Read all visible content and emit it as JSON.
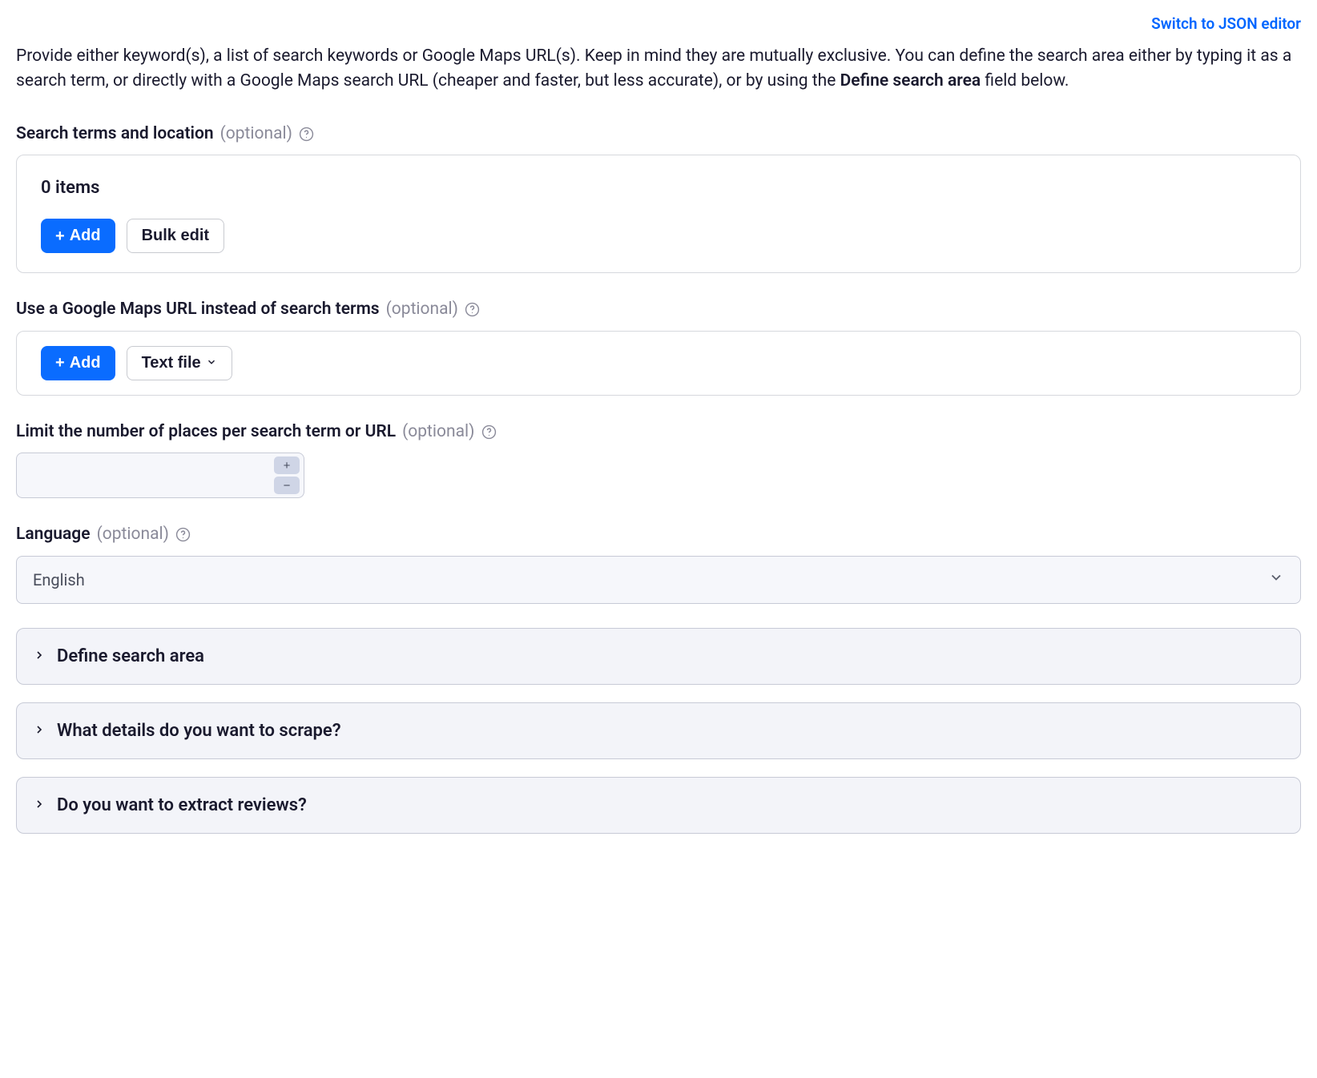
{
  "header": {
    "json_editor_link": "Switch to JSON editor"
  },
  "description": {
    "prefix": "Provide either keyword(s), a list of search keywords or Google Maps URL(s). Keep in mind they are mutually exclusive. You can define the search area either by typing it as a search term, or directly with a Google Maps search URL (cheaper and faster, but less accurate), or by using the ",
    "bold": "Define search area",
    "suffix": " field below."
  },
  "labels": {
    "optional": "(optional)"
  },
  "search_terms": {
    "label": "Search terms and location",
    "items_count": "0 items",
    "add_label": "Add",
    "bulk_edit_label": "Bulk edit"
  },
  "url_section": {
    "label": "Use a Google Maps URL instead of search terms",
    "add_label": "Add",
    "text_file_label": "Text file"
  },
  "limit_section": {
    "label": "Limit the number of places per search term or URL",
    "value": ""
  },
  "language_section": {
    "label": "Language",
    "value": "English"
  },
  "accordions": [
    {
      "title": "Define search area"
    },
    {
      "title": "What details do you want to scrape?"
    },
    {
      "title": "Do you want to extract reviews?"
    }
  ]
}
